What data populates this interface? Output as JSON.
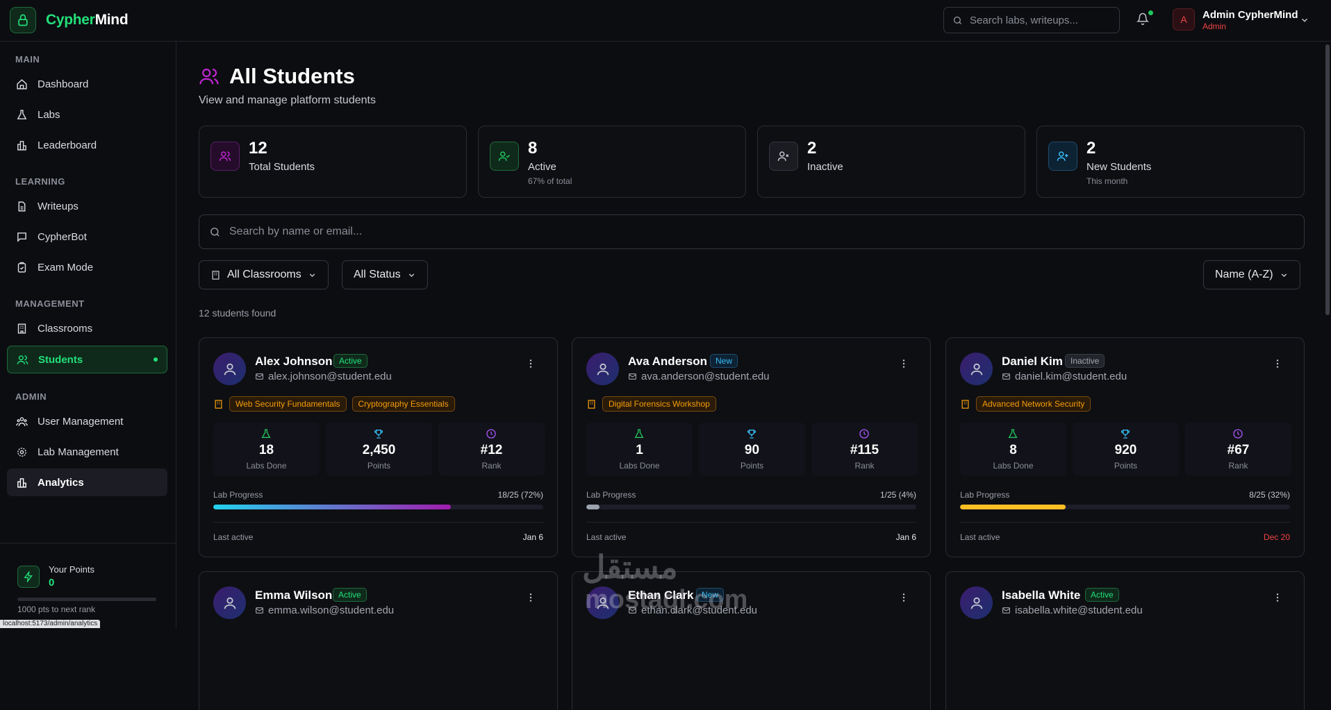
{
  "app": {
    "name_a": "Cypher",
    "name_b": "Mind"
  },
  "header": {
    "search_placeholder": "Search labs, writeups...",
    "user_initial": "A",
    "user_name": "Admin CypherMind",
    "user_role": "Admin"
  },
  "sidebar": {
    "sections": [
      "MAIN",
      "LEARNING",
      "MANAGEMENT",
      "ADMIN"
    ],
    "items": [
      {
        "label": "Dashboard",
        "icon": "home-icon"
      },
      {
        "label": "Labs",
        "icon": "flask-icon"
      },
      {
        "label": "Leaderboard",
        "icon": "bar-chart-icon"
      },
      {
        "label": "Writeups",
        "icon": "file-text-icon"
      },
      {
        "label": "CypherBot",
        "icon": "chat-icon"
      },
      {
        "label": "Exam Mode",
        "icon": "clipboard-icon"
      },
      {
        "label": "Classrooms",
        "icon": "building-icon"
      },
      {
        "label": "Students",
        "icon": "users-icon"
      },
      {
        "label": "User Management",
        "icon": "users-cog-icon"
      },
      {
        "label": "Lab Management",
        "icon": "gear-icon"
      },
      {
        "label": "Analytics",
        "icon": "analytics-icon"
      }
    ],
    "points_label": "Your Points",
    "points_value": "0",
    "points_progress": 0,
    "points_next": "1000 pts to next rank"
  },
  "status_url": "localhost:5173/admin/analytics",
  "page": {
    "title": "All Students",
    "subtitle": "View and manage platform students",
    "search_placeholder": "Search by name or email...",
    "filter_classrooms": "All Classrooms",
    "filter_status": "All Status",
    "sort": "Name (A-Z)",
    "found": "12 students found"
  },
  "stats": [
    {
      "value": "12",
      "label": "Total Students",
      "sub": "",
      "color": "#c026d3"
    },
    {
      "value": "8",
      "label": "Active",
      "sub": "67% of total",
      "color": "#22c55e"
    },
    {
      "value": "2",
      "label": "Inactive",
      "sub": "",
      "color": "#a3a6af"
    },
    {
      "value": "2",
      "label": "New Students",
      "sub": "This month",
      "color": "#38bdf8"
    }
  ],
  "labels": {
    "labs_done": "Labs Done",
    "points": "Points",
    "rank": "Rank",
    "lab_progress": "Lab Progress",
    "last_active": "Last active"
  },
  "students": [
    {
      "name": "Alex Johnson",
      "status": "Active",
      "email": "alex.johnson@student.edu",
      "classes": [
        "Web Security Fundamentals",
        "Cryptography Essentials"
      ],
      "labs": "18",
      "points": "2,450",
      "rank": "#12",
      "progress_text": "18/25 (72%)",
      "progress": 72,
      "last": "Jan 6"
    },
    {
      "name": "Ava Anderson",
      "status": "New",
      "email": "ava.anderson@student.edu",
      "classes": [
        "Digital Forensics Workshop"
      ],
      "labs": "1",
      "points": "90",
      "rank": "#115",
      "progress_text": "1/25 (4%)",
      "progress": 4,
      "last": "Jan 6"
    },
    {
      "name": "Daniel Kim",
      "status": "Inactive",
      "email": "daniel.kim@student.edu",
      "classes": [
        "Advanced Network Security"
      ],
      "labs": "8",
      "points": "920",
      "rank": "#67",
      "progress_text": "8/25 (32%)",
      "progress": 32,
      "last": "Dec 20"
    },
    {
      "name": "Emma Wilson",
      "status": "Active",
      "email": "emma.wilson@student.edu"
    },
    {
      "name": "Ethan Clark",
      "status": "New",
      "email": "ethan.clark@student.edu"
    },
    {
      "name": "Isabella White",
      "status": "Active",
      "email": "isabella.white@student.edu"
    }
  ],
  "watermark": {
    "line1": "مستقل",
    "line2": "mostaql.com"
  },
  "colors": {
    "accent": "#22e07a",
    "danger": "#ef4444",
    "amber": "#f59e0b"
  }
}
